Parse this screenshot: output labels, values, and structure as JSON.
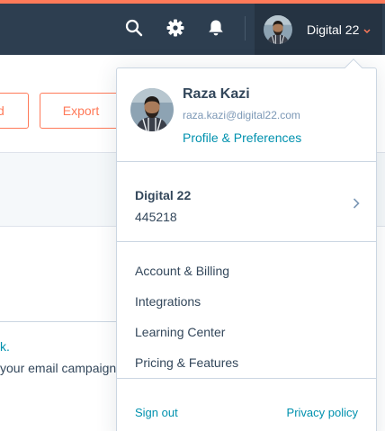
{
  "nav": {
    "icons": [
      "search-icon",
      "gear-icon",
      "bell-icon"
    ],
    "account_label": "Digital 22",
    "caret_icon": "chevron-down-icon"
  },
  "page": {
    "left_button_fragment": "d",
    "export_label": "Export",
    "link_fragment": "k.",
    "text_fragment": "your email campaign"
  },
  "dropdown": {
    "user_name": "Raza Kazi",
    "user_email": "raza.kazi@digital22.com",
    "profile_link": "Profile & Preferences",
    "portal_name": "Digital 22",
    "portal_id": "445218",
    "menu_items": [
      "Account & Billing",
      "Integrations",
      "Learning Center",
      "Pricing & Features"
    ],
    "sign_out": "Sign out",
    "privacy_policy": "Privacy policy"
  },
  "colors": {
    "nav_bg": "#2d3e50",
    "accent_orange": "#ff7a59",
    "link_teal": "#0091ae",
    "text_dark": "#33475b"
  }
}
